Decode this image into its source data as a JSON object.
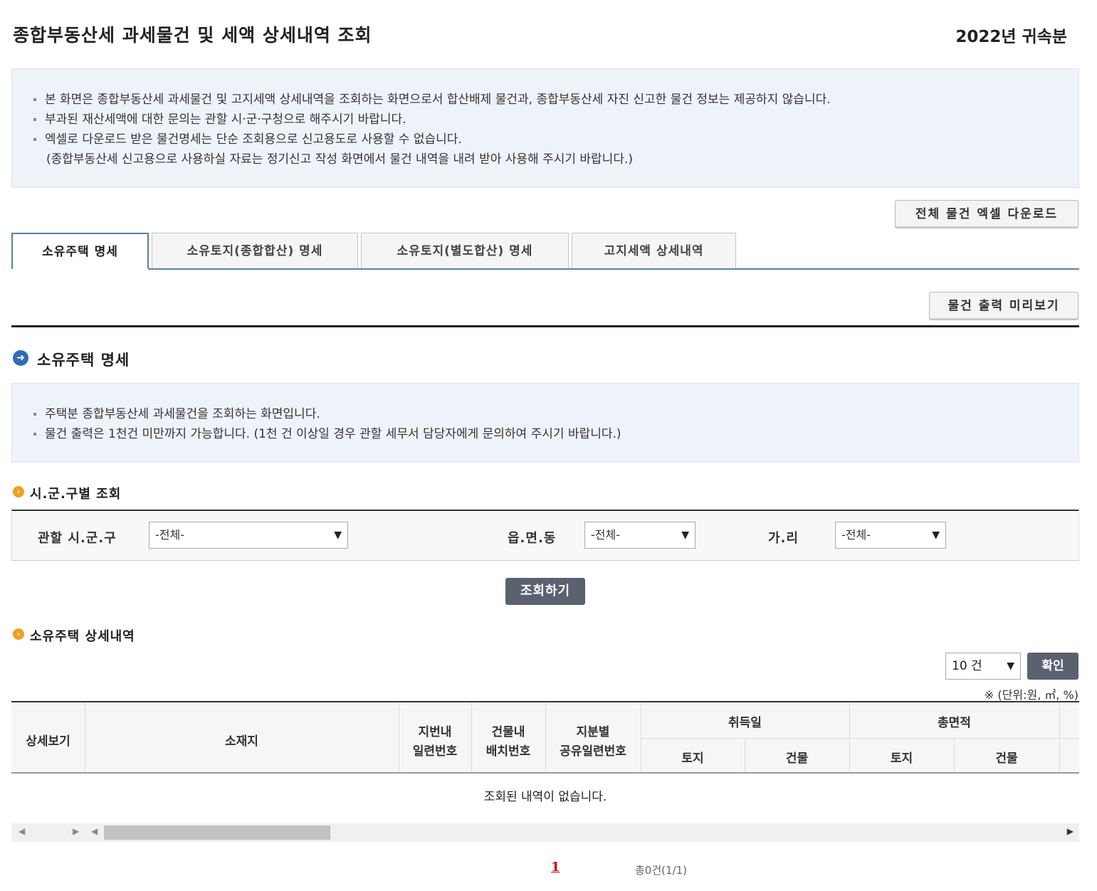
{
  "header": {
    "title": "종합부동산세 과세물건 및 세액 상세내역 조회",
    "year": "2022년 귀속분"
  },
  "notice_top": {
    "lines": [
      "본 화면은 종합부동산세 과세물건 및 고지세액 상세내역을 조회하는 화면으로서 합산배제 물건과, 종합부동산세 자진 신고한 물건 정보는 제공하지 않습니다.",
      "부과된 재산세액에 대한 문의는 관할 시·군·구청으로 해주시기 바랍니다.",
      "엑셀로 다운로드 받은 물건명세는 단순 조회용으로 신고용도로 사용할 수 없습니다."
    ],
    "sub_line": "(종합부동산세 신고용으로 사용하실 자료는 정기신고 작성 화면에서 물건 내역을 내려 받아 사용해 주시기 바랍니다.)"
  },
  "buttons": {
    "excel_download": "전체 물건 엑셀 다운로드",
    "print_preview": "물건 출력 미리보기",
    "search": "조회하기",
    "confirm": "확인"
  },
  "tabs": [
    {
      "label": "소유주택 명세",
      "active": true
    },
    {
      "label": "소유토지(종합합산) 명세",
      "active": false
    },
    {
      "label": "소유토지(별도합산) 명세",
      "active": false
    },
    {
      "label": "고지세액 상세내역",
      "active": false
    }
  ],
  "section": {
    "title": "소유주택 명세",
    "notice_lines": [
      "주택분 종합부동산세 과세물건을 조회하는 화면입니다.",
      "물건 출력은 1천건 미만까지 가능합니다. (1천 건 이상일 경우 관할 세무서 담당자에게 문의하여 주시기 바랍니다.)"
    ]
  },
  "search": {
    "subtitle": "시.군.구별 조회",
    "sigungu_label": "관할 시.군.구",
    "sigungu_value": "-전체-",
    "eup_label": "읍.면.동",
    "eup_value": "-전체-",
    "ri_label": "가.리",
    "ri_value": "-전체-"
  },
  "detail": {
    "subtitle": "소유주택 상세내역",
    "page_size": "10 건",
    "unit_note": "※ (단위:원, ㎡, %)",
    "columns": {
      "view": "상세보기",
      "location": "소재지",
      "jibun_serial_1": "지번내",
      "jibun_serial_2": "일련번호",
      "bldg_serial_1": "건물내",
      "bldg_serial_2": "배치번호",
      "share_serial_1": "지분별",
      "share_serial_2": "공유일련번호",
      "acq_date": "취득일",
      "acq_land": "토지",
      "acq_bldg": "건물",
      "total_area": "총면적",
      "area_land": "토지",
      "area_bldg": "건물"
    },
    "empty_message": "조회된 내역이 없습니다."
  },
  "pagination": {
    "current": "1",
    "total_text": "총0건(1/1)"
  },
  "colors": {
    "accent_blue": "#2f6db3",
    "accent_orange": "#f0a020",
    "button_dark": "#5a6270",
    "page_red": "#cc0000"
  }
}
